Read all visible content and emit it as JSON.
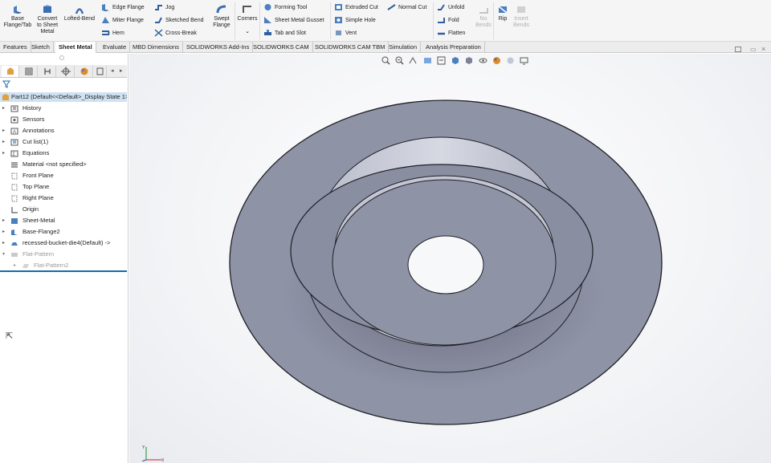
{
  "ribbon": {
    "base_flange": "Base Flange/Tab",
    "convert": "Convert to Sheet Metal",
    "lofted_bend": "Lofted-Bend",
    "edge_flange": "Edge Flange",
    "miter_flange": "Miter Flange",
    "hem": "Hem",
    "jog": "Jog",
    "sketched_bend": "Sketched Bend",
    "cross_break": "Cross-Break",
    "swept_flange": "Swept Flange",
    "corners": "Corners",
    "forming_tool": "Forming Tool",
    "gusset": "Sheet Metal Gusset",
    "tab_slot": "Tab and Slot",
    "extruded_cut": "Extruded Cut",
    "simple_hole": "Simple Hole",
    "vent": "Vent",
    "normal_cut": "Normal Cut",
    "unfold": "Unfold",
    "fold": "Fold",
    "flatten": "Flatten",
    "no_bends": "No Bends",
    "rip": "Rip",
    "insert_bends": "Insert Bends"
  },
  "tabs": [
    "Features",
    "Sketch",
    "Sheet Metal",
    "Evaluate",
    "MBD Dimensions",
    "SOLIDWORKS Add-Ins",
    "SOLIDWORKS CAM",
    "SOLIDWORKS CAM TBM",
    "Simulation",
    "Analysis Preparation"
  ],
  "active_tab": "Sheet Metal",
  "tree": {
    "root": "Part12  (Default<<Default>_Display State 1>",
    "items": [
      {
        "label": "History"
      },
      {
        "label": "Sensors"
      },
      {
        "label": "Annotations"
      },
      {
        "label": "Cut list(1)"
      },
      {
        "label": "Equations"
      },
      {
        "label": "Material <not specified>"
      },
      {
        "label": "Front Plane"
      },
      {
        "label": "Top Plane"
      },
      {
        "label": "Right Plane"
      },
      {
        "label": "Origin"
      },
      {
        "label": "Sheet-Metal"
      },
      {
        "label": "Base-Flange2"
      },
      {
        "label": "recessed-bucket-die4(Default) ->"
      },
      {
        "label": "Flat-Pattern"
      },
      {
        "label": "Flat-Pattern2"
      }
    ]
  },
  "colors": {
    "part": "#8f93a6",
    "edge": "#1e1f26",
    "selection": "#cfe2f3",
    "accent": "#1a6aa5"
  },
  "icons": [
    "base-flange-icon",
    "convert-sheet-metal-icon",
    "lofted-bend-icon",
    "edge-flange-icon",
    "miter-flange-icon",
    "hem-icon",
    "jog-icon",
    "sketched-bend-icon",
    "cross-break-icon",
    "swept-flange-icon",
    "corners-icon",
    "forming-tool-icon",
    "gusset-icon",
    "tab-slot-icon",
    "extruded-cut-icon",
    "simple-hole-icon",
    "vent-icon",
    "normal-cut-icon",
    "unfold-icon",
    "fold-icon",
    "flatten-icon",
    "no-bends-icon",
    "rip-icon",
    "insert-bends-icon",
    "filter-icon",
    "triad-icon"
  ]
}
